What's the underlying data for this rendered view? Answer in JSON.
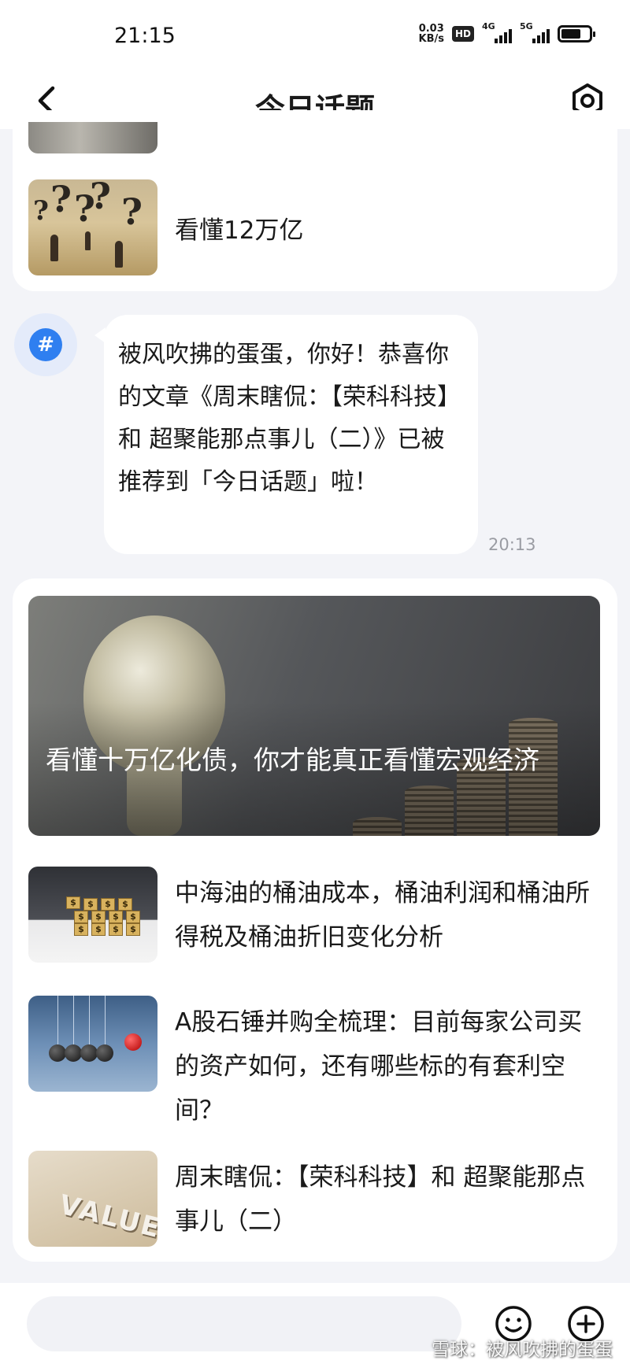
{
  "status_bar": {
    "time": "21:15",
    "net_speed_value": "0.03",
    "net_speed_unit": "KB/s",
    "hd_badge": "HD",
    "signal_1_label": "4G",
    "signal_2_label": "5G",
    "battery_level": 0.7
  },
  "header": {
    "title": "今日话题",
    "back_icon": "chevron-left-icon",
    "settings_icon": "settings-hexagon-icon"
  },
  "card1": {
    "item_title": "看懂12万亿"
  },
  "message": {
    "avatar_icon": "hashtag-icon",
    "text": "被风吹拂的蛋蛋，你好！恭喜你的文章《周末瞎侃：【荣科科技】和 超聚能那点事儿（二）》已被推荐到「今日话题」啦！",
    "time": "20:13"
  },
  "card2": {
    "hero_title": "看懂十万亿化债，你才能真正看懂宏观经济",
    "items": [
      {
        "title": "中海油的桶油成本，桶油利润和桶油所得税及桶油折旧变化分析"
      },
      {
        "title": "A股石锤并购全梳理：目前每家公司买的资产如何，还有哪些标的有套利空间？"
      },
      {
        "title": "周末瞎侃：【荣科科技】和 超聚能那点事儿（二）"
      }
    ]
  },
  "thumbnails": {
    "value_word": "VALUE",
    "dollar_sign": "$"
  },
  "input_bar": {
    "placeholder": "",
    "emoji_icon": "smiley-icon",
    "plus_icon": "plus-circle-icon"
  },
  "watermark": "雪球：被风吹拂的蛋蛋",
  "colors": {
    "accent": "#2f7ff0",
    "background": "#f3f4f8",
    "card": "#ffffff"
  }
}
